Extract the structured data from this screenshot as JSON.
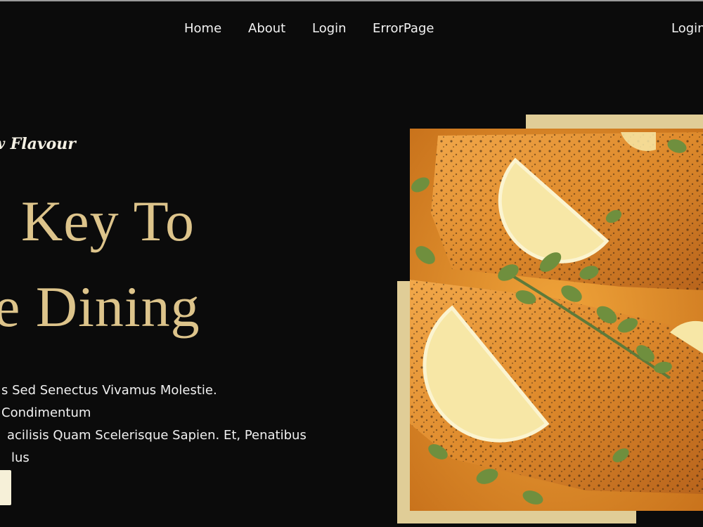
{
  "nav": {
    "items": [
      "Home",
      "About",
      "Login",
      "ErrorPage"
    ],
    "login_button": "Login"
  },
  "hero": {
    "subtitle": "w Flavour",
    "headline_line1": "Key To",
    "headline_line2": "e Dining",
    "description": "s Sed Senectus Vivamus Molestie. Condimentum acilisis Quam Scelerisque Sapien. Et, Penatibus lus",
    "description_lines": [
      "s Sed Senectus Vivamus Molestie. Condimentum",
      "acilisis Quam Scelerisque Sapien. Et, Penatibus",
      "lus"
    ]
  },
  "colors": {
    "background": "#0b0b0b",
    "accent_gold": "#ddc48b",
    "frame_gold": "#e0cd97",
    "food_orange": "#e5922a"
  },
  "image": {
    "icon": "salmon-dish-photo"
  }
}
